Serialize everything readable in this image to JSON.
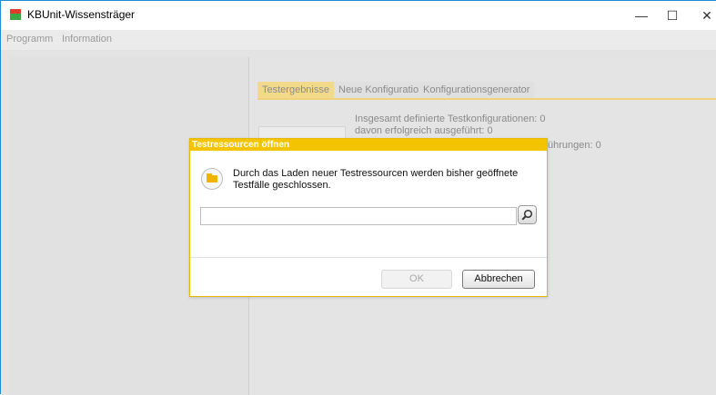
{
  "window": {
    "title": "KBUnit-Wissensträger"
  },
  "window_controls": {
    "minimize": "—",
    "maximize": "☐",
    "close": "✕"
  },
  "menu": {
    "items": [
      "Programm",
      "Information"
    ]
  },
  "tabs": [
    "Testergebnisse",
    "Neue Konfiguration",
    "Konfigurationsgenerator"
  ],
  "stats": {
    "line1": "Insgesamt definierte Testkonfigurationen: 0",
    "line2": "davon erfolgreich ausgeführt: 0",
    "line3": "ührungen: 0"
  },
  "dialog": {
    "title": "Testressourcen öffnen",
    "message_line1": "Durch das Laden neuer Testressourcen werden bisher geöffnete",
    "message_line2": "Testfälle geschlossen.",
    "input_value": "",
    "ok_label": "OK",
    "cancel_label": "Abbrechen"
  },
  "colors": {
    "accent": "#f5c400",
    "tab_active": "#f3d98a",
    "window_border": "#1a8fd8"
  }
}
